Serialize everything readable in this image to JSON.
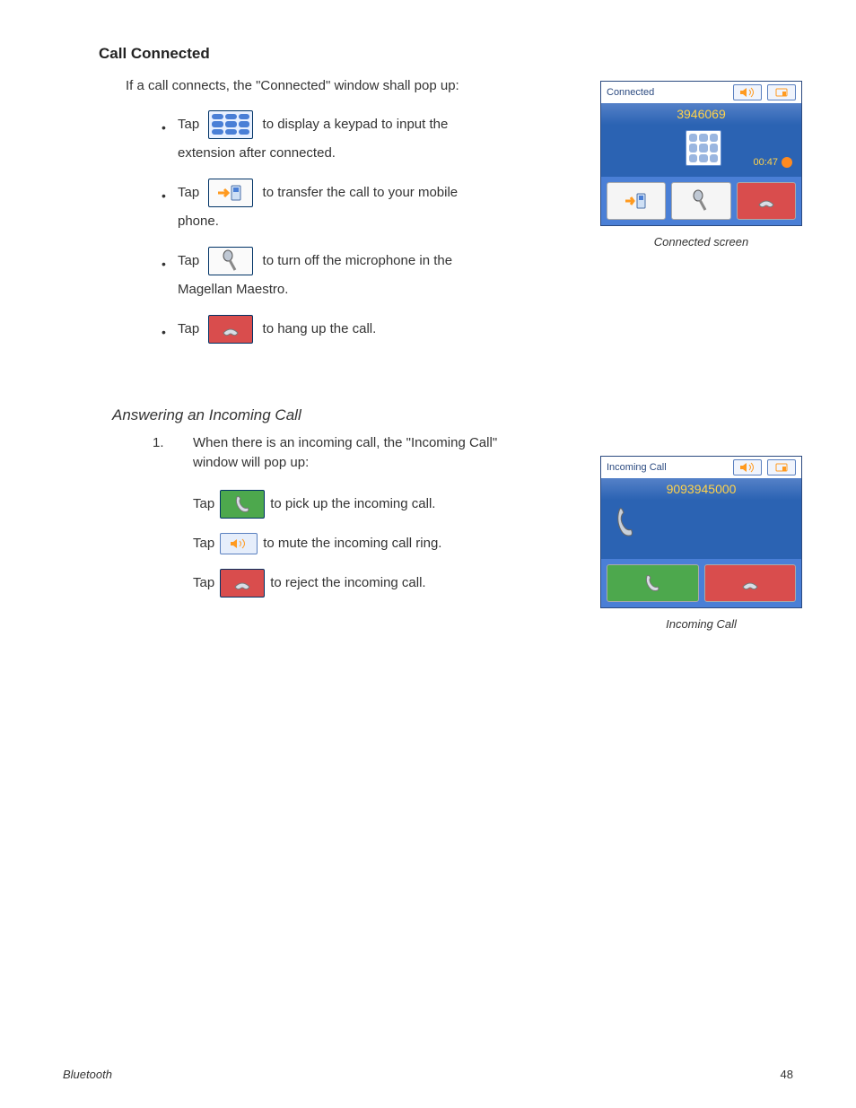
{
  "section1": {
    "title": "Call Connected",
    "intro": "If a call connects, the \"Connected\" window shall pop up:",
    "bullets": {
      "tap": "Tap",
      "b1_after": " to display a keypad to input the",
      "b1_line2": "extension after connected.",
      "b2_after": " to transfer the call to your mobile",
      "b2_line2": "phone.",
      "b3_after": " to turn off the microphone in the",
      "b3_line2": "Magellan Maestro.",
      "b4_after": " to hang up the call."
    }
  },
  "screenshot1": {
    "header_title": "Connected",
    "number": "3946069",
    "timer": "00:47",
    "caption": "Connected screen"
  },
  "section2": {
    "title": "Answering an Incoming Call",
    "item1": "When there is an incoming call, the \"Incoming Call\" window will pop up:",
    "taps": {
      "tap": "Tap",
      "green_after": " to pick up the incoming call.",
      "mute_after": " to mute the incoming call ring.",
      "red_after": " to reject the incoming call."
    }
  },
  "screenshot2": {
    "header_title": "Incoming Call",
    "number": "9093945000",
    "caption": "Incoming Call"
  },
  "footer": {
    "label": "Bluetooth",
    "page": "48"
  }
}
